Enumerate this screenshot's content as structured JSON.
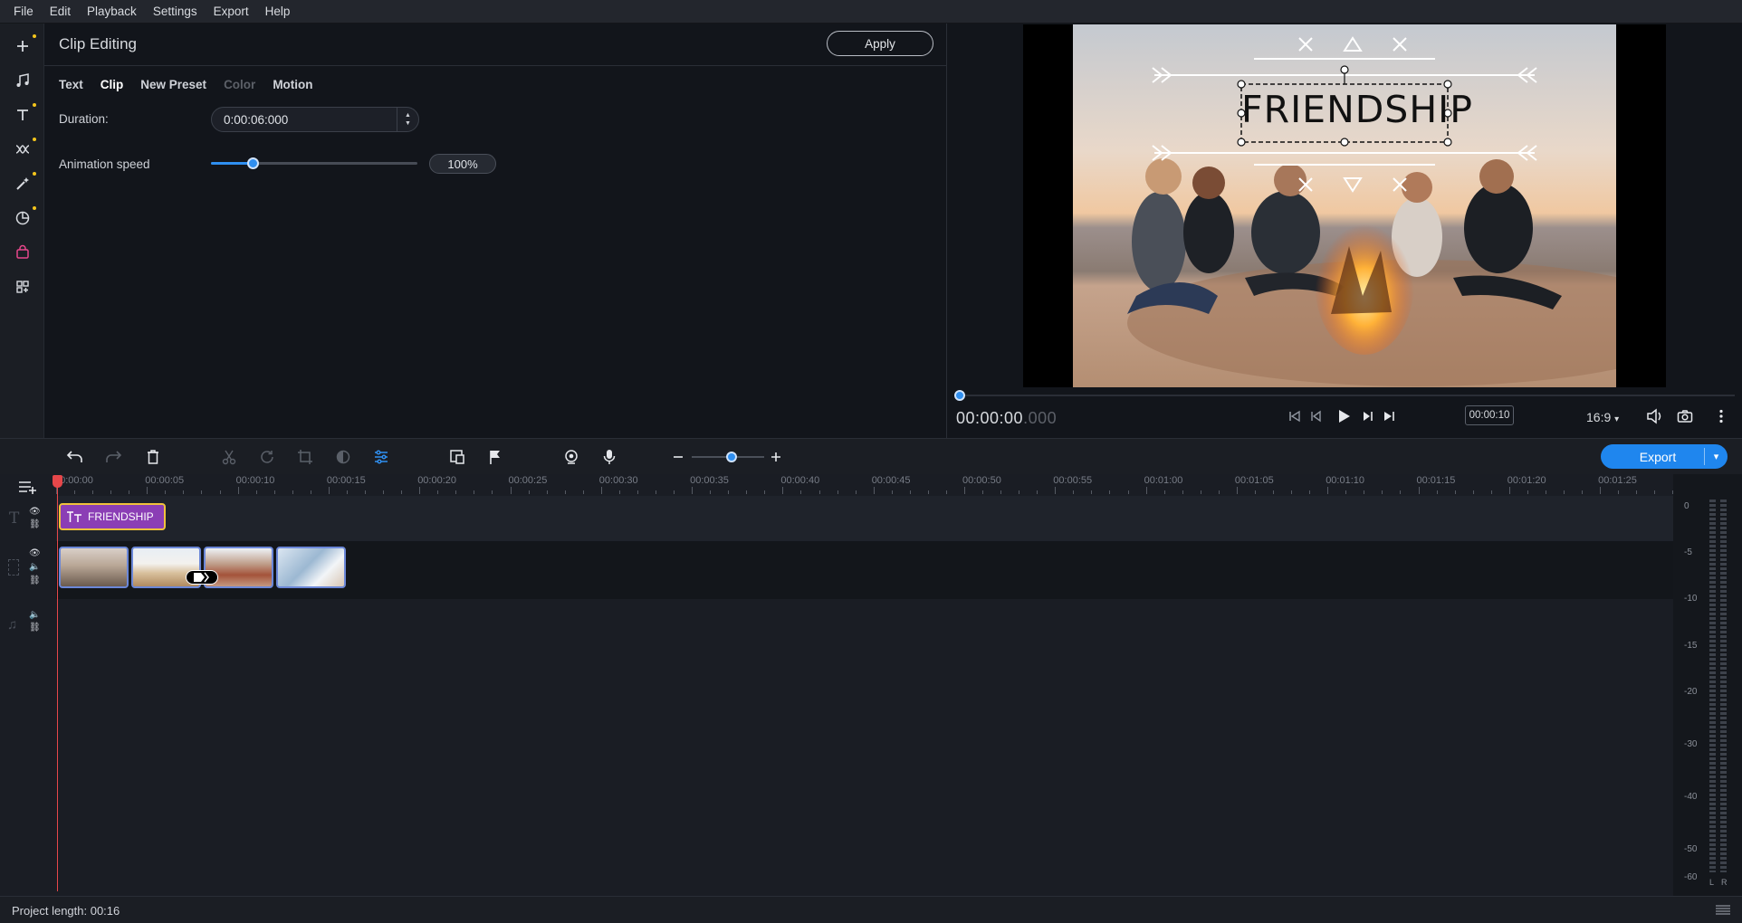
{
  "menu": [
    "File",
    "Edit",
    "Playback",
    "Settings",
    "Export",
    "Help"
  ],
  "panel": {
    "title": "Clip Editing",
    "apply_label": "Apply",
    "tabs": [
      "Text",
      "Clip",
      "New Preset",
      "Color",
      "Motion"
    ],
    "active_tab": "Clip",
    "duration_label": "Duration:",
    "duration_value": "0:00:06:000",
    "animation_speed_label": "Animation speed",
    "animation_speed_value": "100%",
    "animation_speed_level": 0.2
  },
  "preview": {
    "overlay_text": "FRIENDSHIP",
    "timecode_main": "00:00:00",
    "timecode_ms": ".000",
    "timecode_small": "00:00:10",
    "aspect_ratio": "16:9",
    "position": 0
  },
  "toolbar": {
    "export_label": "Export",
    "zoom_level": 0.55
  },
  "timeline": {
    "ruler_labels": [
      "00:00:00",
      "00:00:05",
      "00:00:10",
      "00:00:15",
      "00:00:20",
      "00:00:25",
      "00:00:30",
      "00:00:35",
      "00:00:40",
      "00:00:45",
      "00:00:50",
      "00:00:55",
      "00:01:00",
      "00:01:05",
      "00:01:10",
      "00:01:15",
      "00:01:20",
      "00:01:25"
    ],
    "title_clip_label": "FRIENDSHIP",
    "video_clips": 4
  },
  "meter": {
    "db_labels": [
      "0",
      "-5",
      "-10",
      "-15",
      "-20",
      "-30",
      "-40",
      "-50",
      "-60"
    ],
    "channels": [
      "L",
      "R"
    ]
  },
  "status": {
    "project_length": "Project length: 00:16"
  },
  "colors": {
    "accent": "#1f86ee",
    "title_clip": "#8b3eb5",
    "playhead": "#e6474a",
    "badge_dot": "#f4c51c"
  }
}
